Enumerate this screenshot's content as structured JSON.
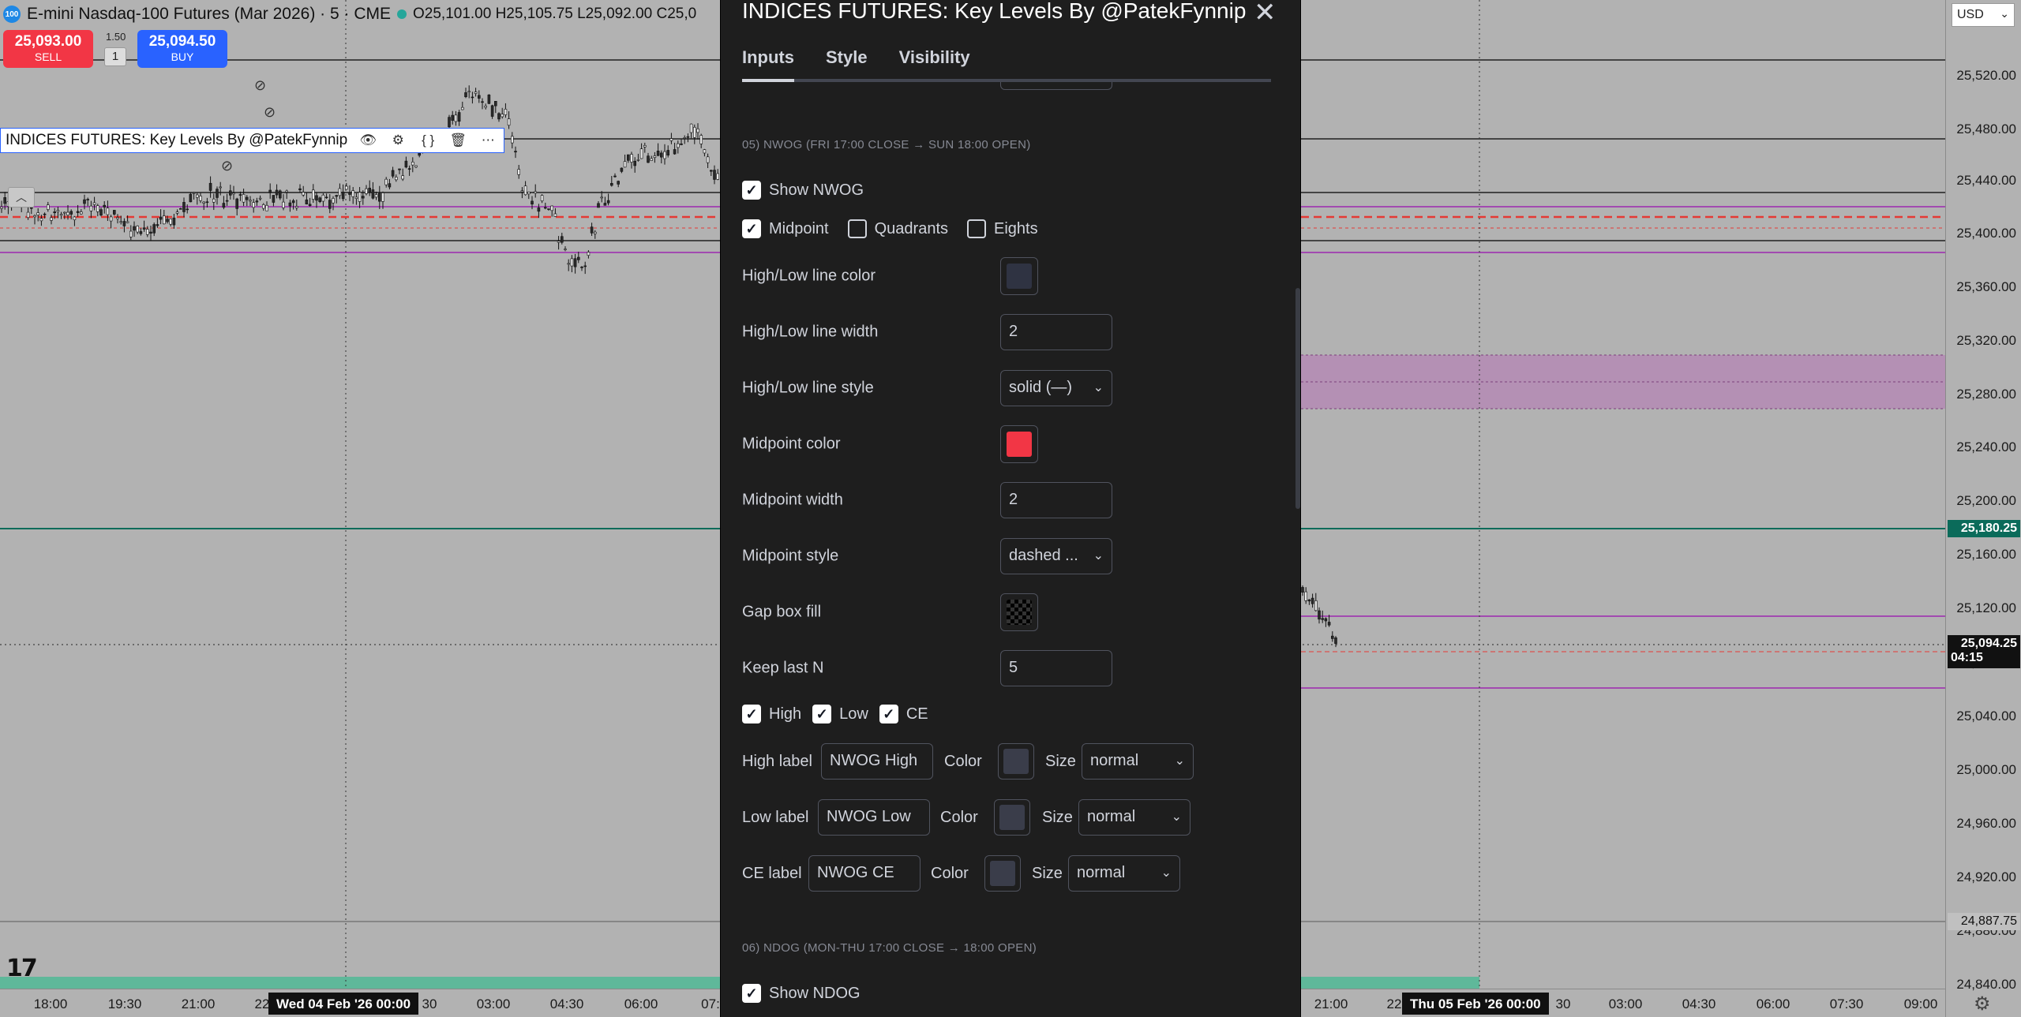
{
  "symbol": {
    "logo_text": "100",
    "name": "E-mini Nasdaq-100 Futures (Mar 2026) · 5 · CME",
    "ohlc": "O25,101.00  H25,105.75  L25,092.00  C25,0"
  },
  "trade": {
    "sell_price": "25,093.00",
    "sell_label": "SELL",
    "buy_price": "25,094.50",
    "buy_label": "BUY",
    "spread": "1.50",
    "qty": "1"
  },
  "indicator_legend": {
    "title": "INDICES FUTURES: Key Levels By @PatekFynnip"
  },
  "price_scale": {
    "currency": "USD",
    "ticks": [
      "25,520.00",
      "25,480.00",
      "25,440.00",
      "25,400.00",
      "25,360.00",
      "25,320.00",
      "25,280.00",
      "25,240.00",
      "25,200.00",
      "25,160.00",
      "25,120.00",
      "25,080.00",
      "25,040.00",
      "25,000.00",
      "24,960.00",
      "24,920.00",
      "24,880.00",
      "24,840.00"
    ],
    "badge_green": "25,180.25",
    "badge_last": "25,094.25",
    "badge_countdown": "04:15",
    "badge_gray": "24,887.75"
  },
  "time_axis": {
    "ticks": [
      "18:00",
      "19:30",
      "21:00",
      "22",
      "30",
      "03:00",
      "04:30",
      "06:00",
      "07:",
      "21:00",
      "22",
      "30",
      "03:00",
      "04:30",
      "06:00",
      "07:30",
      "09:00"
    ],
    "badge_left": "Wed 04 Feb '26   00:00",
    "badge_right": "Thu 05 Feb '26   00:00"
  },
  "dialog": {
    "title": "INDICES FUTURES: Key Levels By @PatekFynnip",
    "tabs": [
      "Inputs",
      "Style",
      "Visibility"
    ],
    "section_nwog": "05) NWOG (FRI 17:00 CLOSE → SUN 18:00 OPEN)",
    "show_nwog": "Show NWOG",
    "midpoint": "Midpoint",
    "quadrants": "Quadrants",
    "eights": "Eights",
    "hl_color_label": "High/Low line color",
    "hl_width_label": "High/Low line width",
    "hl_width_value": "2",
    "hl_style_label": "High/Low line style",
    "hl_style_value": "solid (—)",
    "mid_color_label": "Midpoint color",
    "mid_color": "#f23645",
    "mid_width_label": "Midpoint width",
    "mid_width_value": "2",
    "mid_style_label": "Midpoint style",
    "mid_style_value": "dashed ...",
    "gap_fill_label": "Gap box fill",
    "keep_last_label": "Keep last N",
    "keep_last_value": "5",
    "cb_high": "High",
    "cb_low": "Low",
    "cb_ce": "CE",
    "high_label_label": "High label",
    "high_label_value": "NWOG High",
    "low_label_label": "Low label",
    "low_label_value": "NWOG Low",
    "ce_label_label": "CE label",
    "ce_label_value": "NWOG CE",
    "color_word": "Color",
    "size_word": "Size",
    "size_value": "normal",
    "section_ndog": "06) NDOG (MON-THU 17:00 CLOSE → 18:00 OPEN)",
    "show_ndog": "Show NDOG"
  },
  "colors": {
    "chart_bg": "#b2b2b2",
    "dialog_bg": "#1e1e1e",
    "sell": "#f23645",
    "buy": "#2962ff",
    "teal_line": "#0b6b5a",
    "gap_fill": "#b48ab4",
    "purple_line": "#9c27b0"
  }
}
